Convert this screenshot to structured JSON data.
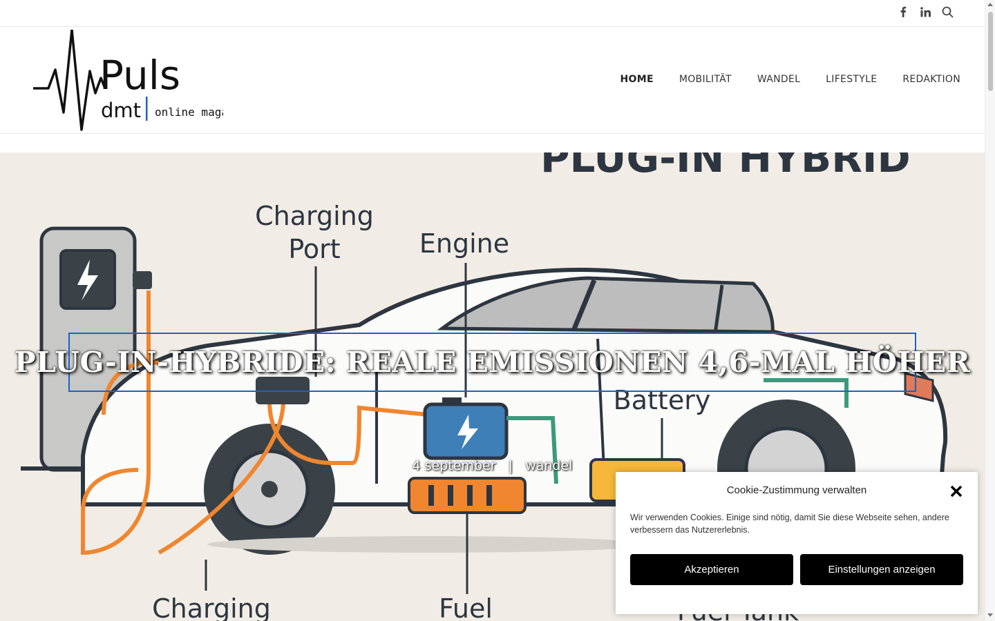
{
  "topbar": {
    "icons": [
      "facebook-icon",
      "linkedin-icon",
      "search-icon"
    ]
  },
  "logo": {
    "wordmark": "Puls",
    "brand": "dmt",
    "tagline": "online magazin"
  },
  "nav": {
    "items": [
      {
        "label": "HOME",
        "active": true
      },
      {
        "label": "MOBILITÄT",
        "active": false
      },
      {
        "label": "WANDEL",
        "active": false
      },
      {
        "label": "LIFESTYLE",
        "active": false
      },
      {
        "label": "REDAKTION",
        "active": false
      }
    ]
  },
  "hero": {
    "title": "Plug-in-Hybride: Reale Emissionen 4,6-mal höher",
    "date": "4 september",
    "separator": "|",
    "category": "wandel",
    "image_labels": {
      "heading": "PLUG-IN HYBRID",
      "charging_port_1": "Charging",
      "charging_port_2": "Port",
      "engine": "Engine",
      "battery": "Battery",
      "charging": "Charging",
      "fuel": "Fuel",
      "fuel_tank": "Fuel Tank"
    }
  },
  "cookie": {
    "title": "Cookie-Zustimmung verwalten",
    "text": "Wir verwenden Cookies. Einige sind nötig, damit Sie diese Webseite sehen, andere verbessern das Nutzererlebnis.",
    "accept_label": "Akzeptieren",
    "settings_label": "Einstellungen anzeigen"
  },
  "colors": {
    "accent_border": "#1a63c7",
    "orange": "#f0862f",
    "battery_blue": "#3f7fb8",
    "teal": "#3c9a7c",
    "hero_bg": "#f1ede6"
  }
}
